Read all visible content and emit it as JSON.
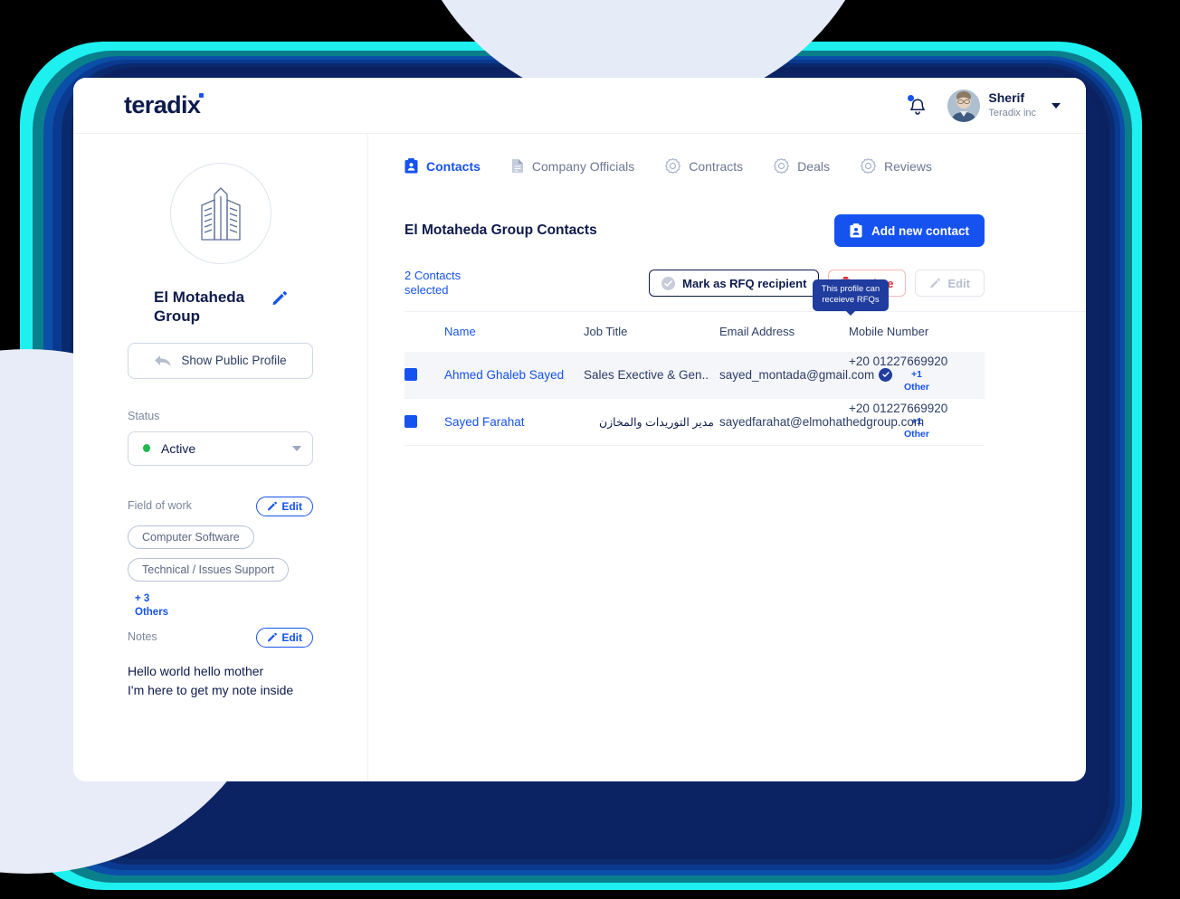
{
  "decor": {
    "colors": {
      "cyan": "#1ef0f0",
      "teal": "#0a7f8c",
      "blue_mid": "#0b4fa8",
      "blue_deep": "#0a3a8f",
      "navy": "#0a2a6e",
      "navy_dark": "#0c2160",
      "lavender": "#e6ebf8",
      "accent": "#1652f0",
      "brand_navy": "#0d1b4c",
      "danger": "#e8282b",
      "success": "#23ba4f",
      "tooltip_bg": "#1f3c9e"
    }
  },
  "topbar": {
    "brand": "teradix",
    "bell_icon": "notification-bell-icon",
    "user": {
      "name": "Sherif",
      "org": "Teradix inc"
    }
  },
  "sidebar": {
    "company_logo_icon": "office-building-icon",
    "company_name": "El Motaheda Group",
    "edit_name_icon": "pencil-icon",
    "public_profile_button": "Show Public Profile",
    "public_profile_icon": "back-arrow-icon",
    "status_label": "Status",
    "status_value": "Active",
    "field_of_work_label": "Field of work",
    "field_of_work_edit": "Edit",
    "tags": [
      "Computer Software",
      "Technical / Issues Support"
    ],
    "more_count": "+ 3",
    "more_label": "Others",
    "notes_label": "Notes",
    "notes_edit": "Edit",
    "notes_text_line1": "Hello world hello mother",
    "notes_text_line2": "I'm here to get my note inside"
  },
  "main": {
    "tabs": [
      {
        "label": "Contacts",
        "icon": "contact-card-icon",
        "active": true
      },
      {
        "label": "Company Officials",
        "icon": "document-icon",
        "active": false
      },
      {
        "label": "Contracts",
        "icon": "badge-gear-icon",
        "active": false
      },
      {
        "label": "Deals",
        "icon": "badge-gear-icon",
        "active": false
      },
      {
        "label": "Reviews",
        "icon": "badge-gear-icon",
        "active": false
      }
    ],
    "panel_title": "El Motaheda Group Contacts",
    "add_contact_label": "Add new contact",
    "add_contact_icon": "contact-card-icon",
    "toolbar": {
      "selected_count_line1": "2  Contacts",
      "selected_count_line2": "selected",
      "rfq_label": "Mark as RFQ recipient",
      "rfq_icon": "check-circle-icon",
      "delete_label": "Delete",
      "delete_icon": "trash-icon",
      "edit_label": "Edit",
      "edit_icon": "pencil-icon"
    },
    "table": {
      "columns": [
        "Name",
        "Job Title",
        "Email Address",
        "Mobile Number"
      ],
      "tooltip": {
        "line1": "This profile can",
        "line2": "receieve RFQs"
      },
      "rows": [
        {
          "selected": true,
          "name": "Ahmed Ghaleb Sayed",
          "job_title": "Sales Exective & Gen..",
          "job_rtl": false,
          "email": "sayed_montada@gmail.com",
          "verified": true,
          "mobile": "+20 01227669920",
          "mobile_more": "+1",
          "mobile_more_label": "Other"
        },
        {
          "selected": true,
          "name": "Sayed Farahat",
          "job_title": "مدير التوريدات والمخازن",
          "job_rtl": true,
          "email": "sayedfarahat@elmohathedgroup.com",
          "verified": false,
          "mobile": "+20 01227669920",
          "mobile_more": "+1",
          "mobile_more_label": "Other"
        }
      ]
    }
  }
}
